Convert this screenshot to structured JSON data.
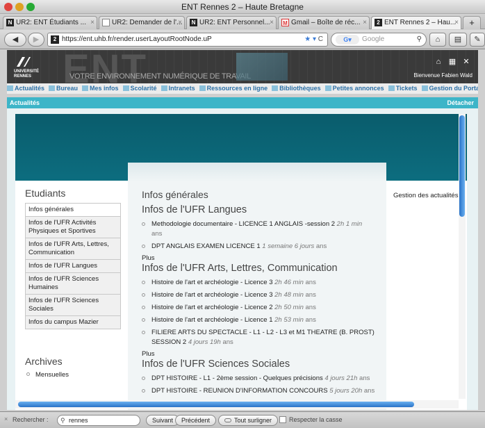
{
  "window": {
    "title": "ENT Rennes 2 – Haute Bretagne"
  },
  "tabs": [
    {
      "label": "UR2: ENT Étudiants ...",
      "icon": "ur2-icon"
    },
    {
      "label": "UR2: Demander de l'...",
      "icon": "page-icon"
    },
    {
      "label": "UR2: ENT Personnel...",
      "icon": "ur2-icon"
    },
    {
      "label": "Gmail – Boîte de réc...",
      "icon": "gmail-icon"
    },
    {
      "label": "ENT Rennes 2 – Hau...",
      "icon": "ent-icon"
    }
  ],
  "toolbar": {
    "url": "https://ent.uhb.fr/render.userLayoutRootNode.uP",
    "search_placeholder": "Google"
  },
  "header": {
    "tagline": "VOTRE ENVIRONNEMENT NUMÉRIQUE DE TRAVAIL",
    "university_line1": "UNIVERSITÉ",
    "university_line2": "RENNES",
    "welcome": "Bienvenue Fabien Wald"
  },
  "menu": [
    "Actualités",
    "Bureau",
    "Mes infos",
    "Scolarité",
    "Intranets",
    "Ressources en ligne",
    "Bibliothèques",
    "Petites annonces",
    "Tickets",
    "Gestion du Portail"
  ],
  "portlet": {
    "title": "Actualités",
    "detach": "Détacher"
  },
  "left": {
    "title": "Etudiants",
    "items": [
      "Infos générales",
      "Infos de l'UFR Activités Physiques et Sportives",
      "Infos de l'UFR Arts, Lettres, Communication",
      "Infos de l'UFR Langues",
      "Infos de l'UFR Sciences Humaines",
      "Infos de l'UFR Sciences Sociales",
      "Infos du campus Mazier"
    ],
    "archives_title": "Archives",
    "archives_item": "Mensuelles"
  },
  "main": {
    "heading": "Infos générales",
    "sections": [
      {
        "title": "Infos de l'UFR Langues",
        "items": [
          {
            "text": "Methodologie documentaire - LICENCE 1 ANGLAIS -session 2",
            "age": "2h 1 min",
            "suffix": "ans"
          },
          {
            "text": "DPT ANGLAIS EXAMEN LICENCE 1",
            "age": "1 semaine 6 jours",
            "suffix": "ans"
          }
        ],
        "plus": "Plus"
      },
      {
        "title": "Infos de l'UFR Arts, Lettres, Communication",
        "items": [
          {
            "text": "Histoire de l'art et archéologie - Licence 3",
            "age": "2h 46 min",
            "suffix": "ans"
          },
          {
            "text": "Histoire de l'art et archéologie - Licence 3",
            "age": "2h 48 min",
            "suffix": "ans"
          },
          {
            "text": "Histoire de l'art et archéologie - Licence 2",
            "age": "2h 50 min",
            "suffix": "ans"
          },
          {
            "text": "Histoire de l'art et archéologie - Licence 1",
            "age": "2h 53 min",
            "suffix": "ans"
          },
          {
            "text": "FILIERE ARTS DU SPECTACLE - L1 - L2 - L3 et M1 THEATRE (B. PROST) SESSION 2",
            "age": "4 jours 19h",
            "suffix": "ans"
          }
        ],
        "plus": "Plus"
      },
      {
        "title": "Infos de l'UFR Sciences Sociales",
        "items": [
          {
            "text": "DPT HISTOIRE - L1 - 2ème session - Quelques précisions",
            "age": "4 jours 21h",
            "suffix": "ans"
          },
          {
            "text": "DPT HISTOIRE - REUNION D'INFORMATION CONCOURS",
            "age": "5 jours 20h",
            "suffix": "ans"
          }
        ]
      }
    ],
    "right_link": "Gestion des actualités"
  },
  "findbar": {
    "label": "Rechercher :",
    "query": "rennes",
    "next": "Suivant",
    "prev": "Précédent",
    "highlight": "Tout surligner",
    "match_case": "Respecter la casse"
  }
}
